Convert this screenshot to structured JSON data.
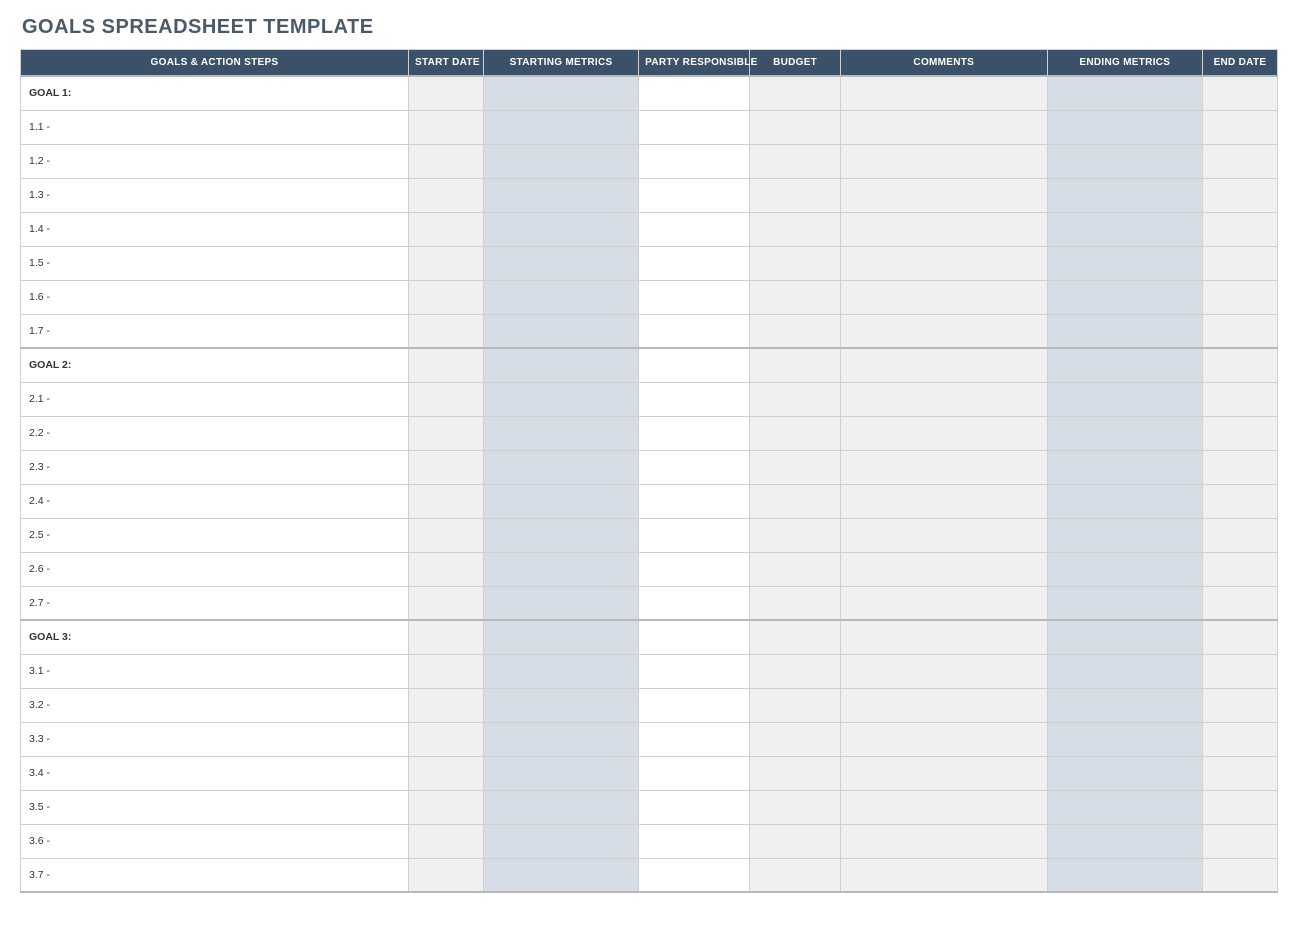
{
  "title": "GOALS SPREADSHEET TEMPLATE",
  "columns": {
    "actions": "GOALS & ACTION STEPS",
    "start_date": "START DATE",
    "start_met": "STARTING METRICS",
    "party": "PARTY RESPONSIBLE",
    "budget": "BUDGET",
    "comments": "COMMENTS",
    "end_met": "ENDING METRICS",
    "end_date": "END DATE"
  },
  "rows": [
    {
      "type": "goal",
      "label": "GOAL 1:"
    },
    {
      "type": "step",
      "label": "1.1 -"
    },
    {
      "type": "step",
      "label": "1.2 -"
    },
    {
      "type": "step",
      "label": "1.3 -"
    },
    {
      "type": "step",
      "label": "1.4 -"
    },
    {
      "type": "step",
      "label": "1.5 -"
    },
    {
      "type": "step",
      "label": "1.6 -"
    },
    {
      "type": "step",
      "label": "1.7 -"
    },
    {
      "type": "goal",
      "label": "GOAL 2:"
    },
    {
      "type": "step",
      "label": "2.1 -"
    },
    {
      "type": "step",
      "label": "2.2 -"
    },
    {
      "type": "step",
      "label": "2.3 -"
    },
    {
      "type": "step",
      "label": "2.4 -"
    },
    {
      "type": "step",
      "label": "2.5 -"
    },
    {
      "type": "step",
      "label": "2.6 -"
    },
    {
      "type": "step",
      "label": "2.7 -"
    },
    {
      "type": "goal",
      "label": "GOAL 3:"
    },
    {
      "type": "step",
      "label": "3.1 -"
    },
    {
      "type": "step",
      "label": "3.2 -"
    },
    {
      "type": "step",
      "label": "3.3 -"
    },
    {
      "type": "step",
      "label": "3.4 -"
    },
    {
      "type": "step",
      "label": "3.5 -"
    },
    {
      "type": "step",
      "label": "3.6 -"
    },
    {
      "type": "step",
      "label": "3.7 -"
    }
  ],
  "cells": {
    "start_date": "",
    "start_met": "",
    "party": "",
    "budget": "",
    "comments": "",
    "end_met": "",
    "end_date": ""
  }
}
